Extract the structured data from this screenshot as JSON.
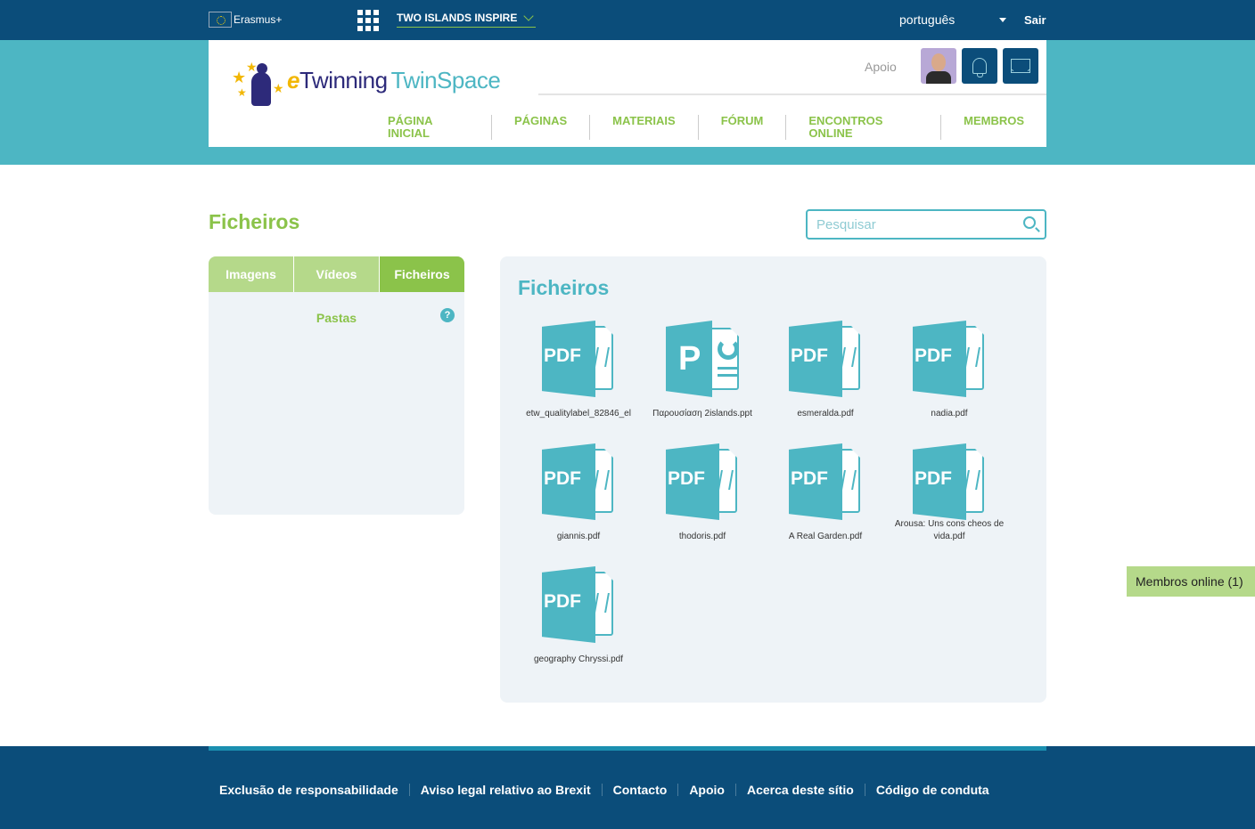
{
  "topbar": {
    "erasmus_label": "Erasmus+",
    "project_name": "TWO ISLANDS INSPIRE",
    "language": "português",
    "logout_label": "Sair"
  },
  "header": {
    "logo": {
      "e": "e",
      "twinning": "Twinning",
      "twinspace": "TwinSpace"
    },
    "support_label": "Apoio",
    "nav": [
      "PÁGINA INICIAL",
      "PÁGINAS",
      "MATERIAIS",
      "FÓRUM",
      "ENCONTROS ONLINE",
      "MEMBROS"
    ]
  },
  "main": {
    "title": "Ficheiros",
    "search_placeholder": "Pesquisar",
    "tabs": [
      {
        "label": "Imagens",
        "active": false
      },
      {
        "label": "Vídeos",
        "active": false
      },
      {
        "label": "Ficheiros",
        "active": true
      }
    ],
    "folders_label": "Pastas",
    "help_glyph": "?",
    "files_title": "Ficheiros",
    "files": [
      {
        "name": "etw_qualitylabel_82846_el",
        "type": "pdf",
        "type_label": "PDF"
      },
      {
        "name": "Παρουσίαση 2islands.ppt",
        "type": "ppt",
        "type_label": "P"
      },
      {
        "name": "esmeralda.pdf",
        "type": "pdf",
        "type_label": "PDF"
      },
      {
        "name": "nadia.pdf",
        "type": "pdf",
        "type_label": "PDF"
      },
      {
        "name": "giannis.pdf",
        "type": "pdf",
        "type_label": "PDF"
      },
      {
        "name": "thodoris.pdf",
        "type": "pdf",
        "type_label": "PDF"
      },
      {
        "name": "A Real Garden.pdf",
        "type": "pdf",
        "type_label": "PDF"
      },
      {
        "name": "Arousa: Uns cons cheos de vida.pdf",
        "type": "pdf",
        "type_label": "PDF"
      },
      {
        "name": "geography Chryssi.pdf",
        "type": "pdf",
        "type_label": "PDF"
      }
    ]
  },
  "members_online_label": "Membros online (1)",
  "footer": {
    "links": [
      "Exclusão de responsabilidade",
      "Aviso legal relativo ao Brexit",
      "Contacto",
      "Apoio",
      "Acerca deste sítio",
      "Código de conduta"
    ]
  },
  "colors": {
    "navy": "#0b4d7a",
    "teal": "#4db6c3",
    "green": "#8bc34a",
    "light_green": "#b5d98a",
    "panel_bg": "#eef3f7"
  }
}
